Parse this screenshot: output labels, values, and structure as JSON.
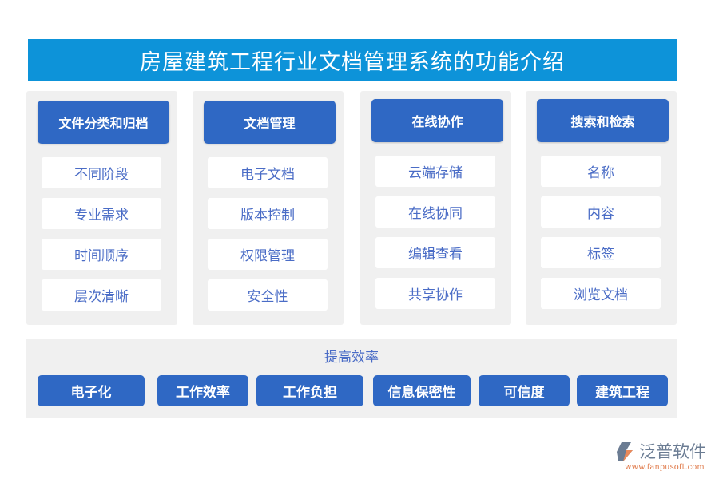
{
  "title": "房屋建筑工程行业文档管理系统的功能介绍",
  "columns": [
    {
      "header": "文件分类和归档",
      "items": [
        "不同阶段",
        "专业需求",
        "时间顺序",
        "层次清晰"
      ]
    },
    {
      "header": "文档管理",
      "items": [
        "电子文档",
        "版本控制",
        "权限管理",
        "安全性"
      ]
    },
    {
      "header": "在线协作",
      "items": [
        "云端存储",
        "在线协同",
        "编辑查看",
        "共享协作"
      ]
    },
    {
      "header": "搜索和检索",
      "items": [
        "名称",
        "内容",
        "标签",
        "浏览文档"
      ]
    }
  ],
  "bottom": {
    "title": "提高效率",
    "buttons": [
      "电子化",
      "工作效率",
      "工作负担",
      "信息保密性",
      "可信度",
      "建筑工程"
    ]
  },
  "logo": {
    "name": "泛普软件",
    "url": "www.fanpusoft.com"
  },
  "colors": {
    "title_bar": "#0d93d9",
    "header": "#2f68c4",
    "item_text": "#4a6cc6",
    "panel": "#f0f0f0"
  }
}
